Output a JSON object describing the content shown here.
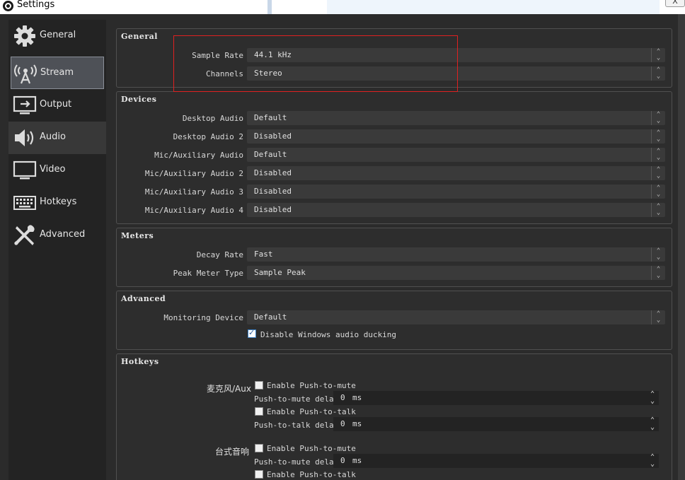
{
  "window": {
    "title": "Settings",
    "close_label": "X"
  },
  "sidebar": {
    "items": [
      {
        "label": "General",
        "icon": "gear-icon"
      },
      {
        "label": "Stream",
        "icon": "broadcast-tower-icon"
      },
      {
        "label": "Output",
        "icon": "monitor-output-icon"
      },
      {
        "label": "Audio",
        "icon": "speaker-icon"
      },
      {
        "label": "Video",
        "icon": "monitor-icon"
      },
      {
        "label": "Hotkeys",
        "icon": "keyboard-icon"
      },
      {
        "label": "Advanced",
        "icon": "wrench-screwdriver-icon"
      }
    ],
    "active": "Stream",
    "hovered": "Audio"
  },
  "general": {
    "title": "General",
    "sample_rate": {
      "label": "Sample Rate",
      "value": "44.1 kHz"
    },
    "channels": {
      "label": "Channels",
      "value": "Stereo"
    }
  },
  "devices": {
    "title": "Devices",
    "rows": [
      {
        "label": "Desktop Audio",
        "value": "Default"
      },
      {
        "label": "Desktop Audio 2",
        "value": "Disabled"
      },
      {
        "label": "Mic/Auxiliary Audio",
        "value": "Default"
      },
      {
        "label": "Mic/Auxiliary Audio 2",
        "value": "Disabled"
      },
      {
        "label": "Mic/Auxiliary Audio 3",
        "value": "Disabled"
      },
      {
        "label": "Mic/Auxiliary Audio 4",
        "value": "Disabled"
      }
    ]
  },
  "meters": {
    "title": "Meters",
    "decay_rate": {
      "label": "Decay Rate",
      "value": "Fast"
    },
    "peak_meter_type": {
      "label": "Peak Meter Type",
      "value": "Sample Peak"
    }
  },
  "advanced": {
    "title": "Advanced",
    "monitoring_device": {
      "label": "Monitoring Device",
      "value": "Default"
    },
    "disable_ducking": {
      "label": "Disable Windows audio ducking",
      "checked": true
    }
  },
  "hotkeys": {
    "title": "Hotkeys",
    "sources": [
      {
        "name": "麦克风/Aux",
        "push_to_mute": {
          "label": "Enable Push-to-mute",
          "checked": false
        },
        "push_to_mute_delay": {
          "label": "Push-to-mute delay",
          "value": "0",
          "unit": "ms"
        },
        "push_to_talk": {
          "label": "Enable Push-to-talk",
          "checked": false
        },
        "push_to_talk_delay": {
          "label": "Push-to-talk delay",
          "value": "0",
          "unit": "ms"
        }
      },
      {
        "name": "台式音响",
        "push_to_mute": {
          "label": "Enable Push-to-mute",
          "checked": false
        },
        "push_to_mute_delay": {
          "label": "Push-to-mute delay",
          "value": "0",
          "unit": "ms"
        },
        "push_to_talk": {
          "label": "Enable Push-to-talk",
          "checked": false
        }
      }
    ]
  },
  "colors": {
    "background": "#2b2b2b",
    "sidebar": "#232323",
    "active_item": "#4e5157",
    "highlight_box": "#e02020"
  }
}
